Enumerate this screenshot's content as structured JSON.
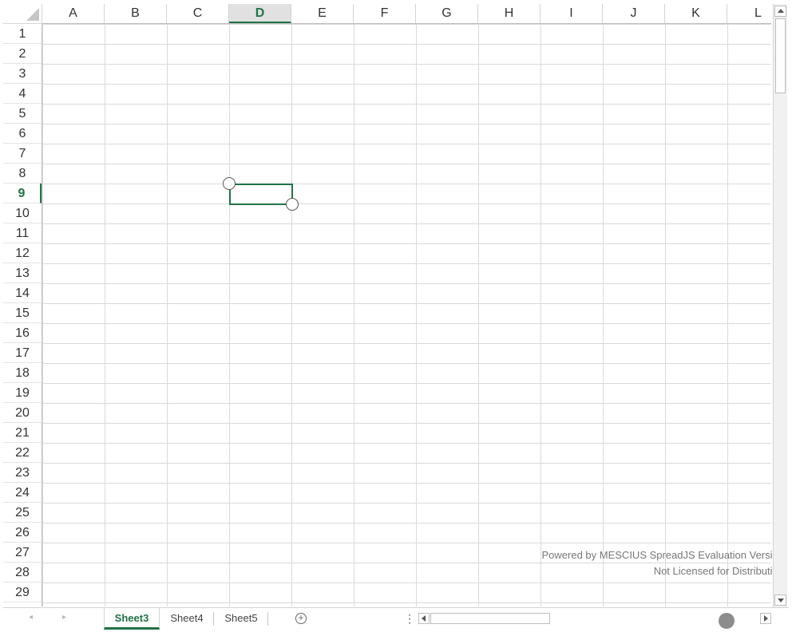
{
  "columns": [
    "A",
    "B",
    "C",
    "D",
    "E",
    "F",
    "G",
    "H",
    "I",
    "J",
    "K",
    "L"
  ],
  "selected_column": "D",
  "rows": [
    "1",
    "2",
    "3",
    "4",
    "5",
    "6",
    "7",
    "8",
    "9",
    "10",
    "11",
    "12",
    "13",
    "14",
    "15",
    "16",
    "17",
    "18",
    "19",
    "20",
    "21",
    "22",
    "23",
    "24",
    "25",
    "26",
    "27",
    "28",
    "29"
  ],
  "selected_row": "9",
  "watermark": {
    "line1": "Powered by MESCIUS SpreadJS Evaluation Version",
    "line2": "Not Licensed for Distribution"
  },
  "tabs": [
    {
      "label": "Sheet3",
      "active": true
    },
    {
      "label": "Sheet4",
      "active": false
    },
    {
      "label": "Sheet5",
      "active": false
    }
  ],
  "icons": {
    "add_sheet": "plus-circle-icon",
    "tab_menu": "vertical-ellipsis-icon",
    "nav_left": "triangle-left-icon",
    "nav_right": "triangle-right-icon"
  },
  "glyphs": {
    "add_sheet": "+",
    "tab_menu": "⋮",
    "nav_left": "◂",
    "nav_right": "▸"
  },
  "colors": {
    "accent": "#217346",
    "selected_header_bg": "#e1e1e1",
    "gridline": "#dadada"
  }
}
